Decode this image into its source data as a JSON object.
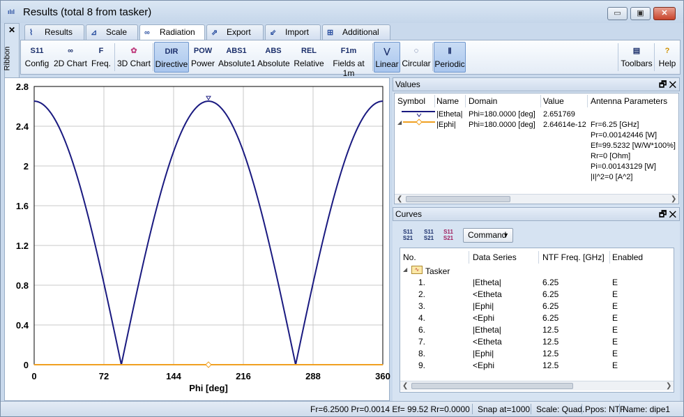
{
  "window": {
    "title": "Results (total 8 from tasker)",
    "icon": "chart-app-icon"
  },
  "sidebar": {
    "close": "✕",
    "label": "Ribbon"
  },
  "tabs": [
    {
      "label": "Results",
      "icon": "results-icon"
    },
    {
      "label": "Scale",
      "icon": "scale-icon"
    },
    {
      "label": "Radiation",
      "icon": "radiation-icon",
      "active": true
    },
    {
      "label": "Export",
      "icon": "export-icon"
    },
    {
      "label": "Import",
      "icon": "import-icon"
    },
    {
      "label": "Additional",
      "icon": "additional-icon"
    }
  ],
  "ribbon": {
    "config": {
      "icon_text": "S11",
      "label": "Config"
    },
    "chart2d": {
      "label": "2D Chart"
    },
    "freq": {
      "icon_text": "F",
      "label": "Freq."
    },
    "chart3d": {
      "label": "3D Chart"
    },
    "directive": {
      "icon_text": "DIR",
      "label": "Directive",
      "selected": true
    },
    "power": {
      "icon_text": "POW",
      "label": "Power"
    },
    "absolute1": {
      "icon_text": "ABS1",
      "label": "Absolute1"
    },
    "absolute": {
      "icon_text": "ABS",
      "label": "Absolute"
    },
    "relative": {
      "icon_text": "REL",
      "label": "Relative"
    },
    "fields": {
      "icon_text": "F1m",
      "label": "Fields at 1m"
    },
    "linear": {
      "label": "Linear",
      "selected": true
    },
    "circular": {
      "label": "Circular"
    },
    "periodic": {
      "label": "Periodic",
      "selected": true
    },
    "toolbars": {
      "label": "Toolbars"
    },
    "help": {
      "label": "Help"
    }
  },
  "chart_data": {
    "type": "line",
    "xlabel": "Phi [deg]",
    "ylabel": "",
    "xlim": [
      0,
      360
    ],
    "ylim": [
      0,
      2.8
    ],
    "x_ticks": [
      "0",
      "72",
      "144",
      "216",
      "288",
      "360"
    ],
    "y_ticks": [
      "0",
      "0.4",
      "0.8",
      "1.2",
      "1.6",
      "2",
      "2.4",
      "2.8"
    ],
    "grid": true,
    "marker_x": 180,
    "series": [
      {
        "name": "|Etheta|",
        "color": "#1a1a80",
        "formula": "2.651769*|cos(phi)|",
        "x": [
          0,
          10,
          20,
          30,
          40,
          50,
          60,
          70,
          80,
          90,
          100,
          110,
          120,
          130,
          140,
          150,
          160,
          170,
          180,
          190,
          200,
          210,
          220,
          230,
          240,
          250,
          260,
          270,
          280,
          290,
          300,
          310,
          320,
          330,
          340,
          350,
          360
        ],
        "values": [
          2.652,
          2.611,
          2.492,
          2.297,
          2.031,
          1.705,
          1.326,
          0.907,
          0.46,
          0,
          0.46,
          0.907,
          1.326,
          1.705,
          2.031,
          2.297,
          2.492,
          2.611,
          2.652,
          2.611,
          2.492,
          2.297,
          2.031,
          1.705,
          1.326,
          0.907,
          0.46,
          0,
          0.46,
          0.907,
          1.326,
          1.705,
          2.031,
          2.297,
          2.492,
          2.611,
          2.652
        ]
      },
      {
        "name": "|Ephi|",
        "color": "#f0a020",
        "formula": "constant",
        "x": [
          0,
          360
        ],
        "values": [
          0,
          0
        ]
      }
    ]
  },
  "values_pane": {
    "title": "Values",
    "columns": [
      "Symbol",
      "Name",
      "Domain",
      "Value",
      "Antenna Parameters"
    ],
    "rows": [
      {
        "name": "|Etheta|",
        "domain": "Phi=180.0000 [deg]",
        "value": "2.651769"
      },
      {
        "name": "|Ephi|",
        "domain": "Phi=180.0000 [deg]",
        "value": "2.64614e-12"
      }
    ],
    "antenna_params": [
      "Fr=6.25 [GHz]",
      "Pr=0.00142446 [W]",
      "Ef=99.5232 [W/W*100%]",
      "Rr=0 [Ohm]",
      "Pi=0.00143129 [W]",
      "|I|^2=0 [A^2]"
    ]
  },
  "curves_pane": {
    "title": "Curves",
    "command_label": "Command",
    "columns": [
      "No.",
      "Data Series",
      "NTF Freq. [GHz]",
      "Enabled"
    ],
    "group": "Tasker",
    "rows": [
      {
        "no": "1.",
        "series": "|Etheta|",
        "freq": "6.25",
        "enabled": "E"
      },
      {
        "no": "2.",
        "series": "<Etheta",
        "freq": "6.25",
        "enabled": "E"
      },
      {
        "no": "3.",
        "series": "|Ephi|",
        "freq": "6.25",
        "enabled": "E"
      },
      {
        "no": "4.",
        "series": "<Ephi",
        "freq": "6.25",
        "enabled": "E"
      },
      {
        "no": "6.",
        "series": "|Etheta|",
        "freq": "12.5",
        "enabled": "E"
      },
      {
        "no": "7.",
        "series": "<Etheta",
        "freq": "12.5",
        "enabled": "E"
      },
      {
        "no": "8.",
        "series": "|Ephi|",
        "freq": "12.5",
        "enabled": "E"
      },
      {
        "no": "9.",
        "series": "<Ephi",
        "freq": "12.5",
        "enabled": "E"
      }
    ]
  },
  "status": {
    "readout": "Fr=6.2500 Pr=0.0014 Ef= 99.52 Rr=0.0000",
    "snap": "Snap at=1000",
    "scale": "Scale: Quad.",
    "ppos": "Ppos: NTF",
    "name": "Name: dipe1"
  }
}
